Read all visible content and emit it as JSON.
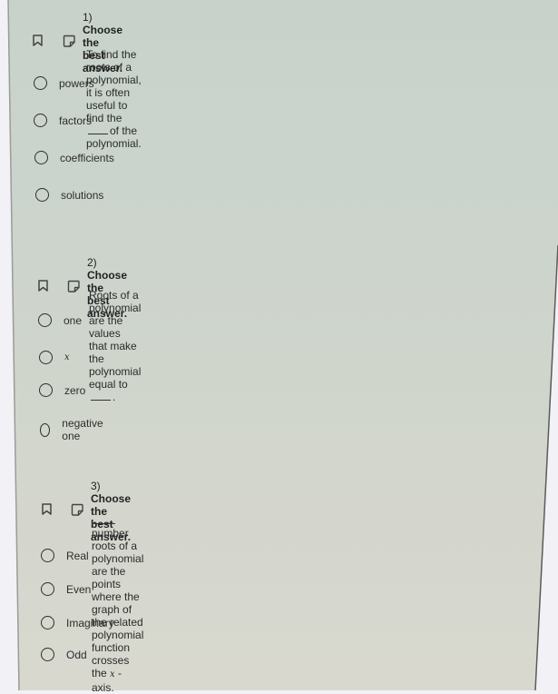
{
  "questions": [
    {
      "number": "1)",
      "title": "Choose the best answer.",
      "prompt_before": "To find the roots of a polynomial, it is often useful to find the",
      "prompt_after": "of the polynomial.",
      "options": [
        "powers",
        "factors",
        "coefficients",
        "solutions"
      ]
    },
    {
      "number": "2)",
      "title": "Choose the best answer.",
      "prompt_before": "Roots of a polynomial are the values that make the polynomial equal to",
      "prompt_after": ".",
      "options": [
        "one",
        "x",
        "zero",
        "negative one"
      ]
    },
    {
      "number": "3)",
      "title": "Choose the best answer.",
      "prompt_line1_after": "number roots of a polynomial are the points where the graph of the related polynomial",
      "prompt_line2_before": "function crosses the",
      "prompt_line2_var": "x",
      "prompt_line2_after": "-axis.",
      "options": [
        "Real",
        "Even",
        "Imaginary",
        "Odd"
      ]
    }
  ],
  "icons": {
    "bookmark": "bookmark-icon",
    "note": "note-icon",
    "radio": "radio-button"
  },
  "colors": {
    "panel_top": "#c8d2cb",
    "panel_bottom": "#d8d8cf",
    "text": "#2a2a2a",
    "outside": "#f2f1f5"
  }
}
